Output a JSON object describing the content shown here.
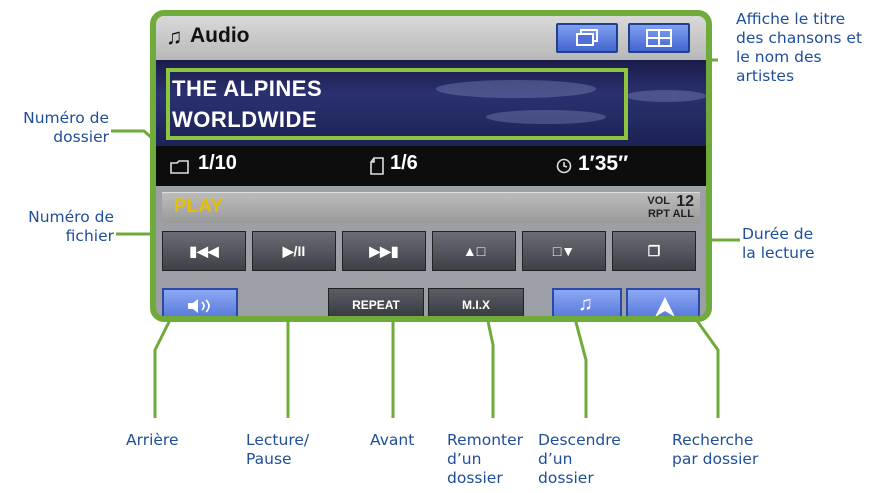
{
  "screen": {
    "app_title": "Audio",
    "song_line1": "THE ALPINES",
    "song_line2": "WORLDWIDE",
    "folder_number": "1/10",
    "file_number": "1/6",
    "elapsed_time": "1′35″",
    "play_status": "PLAY",
    "vol_label": "VOL",
    "vol_value": "12",
    "repeat_status": "RPT ALL",
    "controls": {
      "prev": "▮◀◀",
      "play_pause": "▶/II",
      "next": "▶▶▮",
      "folder_up": "▲□",
      "folder_down": "□▼",
      "folder_search": "❐"
    },
    "bottom_buttons": {
      "repeat": "REPEAT",
      "mix": "M.I.X"
    }
  },
  "callouts": {
    "song_title": [
      "Affiche le titre",
      "des chansons et",
      "le nom des",
      "artistes"
    ],
    "folder_number": [
      "Numéro de",
      "dossier"
    ],
    "file_number": [
      "Numéro de",
      "fichier"
    ],
    "duration": [
      "Durée de",
      "la lecture"
    ],
    "rewind": [
      "Arrière"
    ],
    "play_pause": [
      "Lecture/",
      "Pause"
    ],
    "forward": [
      "Avant"
    ],
    "folder_up": [
      "Remonter",
      "d’un",
      "dossier"
    ],
    "folder_down": [
      "Descendre",
      "d’un",
      "dossier"
    ],
    "folder_search": [
      "Recherche",
      "par dossier"
    ]
  },
  "colors": {
    "callout_text": "#1f4e9a",
    "leader_lines": "#6fab3b",
    "play_status": "#e6c000"
  },
  "icons": [
    "music-note-icon",
    "window-icon",
    "split-screen-icon",
    "folder-icon",
    "file-icon",
    "clock-icon",
    "speaker-icon",
    "navigation-arrow-icon"
  ]
}
